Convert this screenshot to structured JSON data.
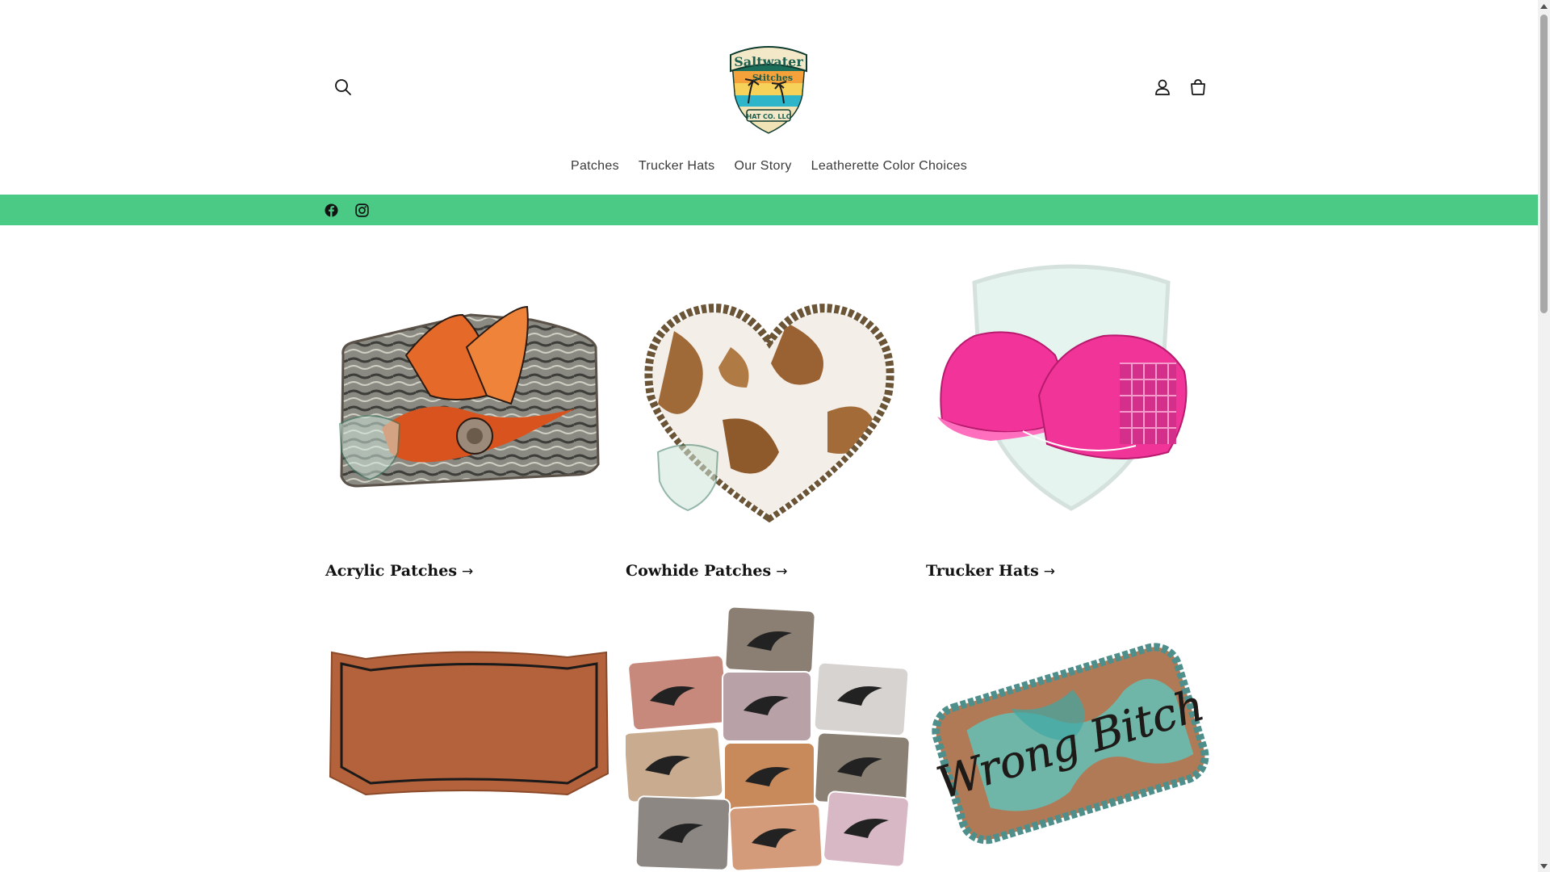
{
  "brand": {
    "logo_line1": "Saltwater",
    "logo_line2": "Stitches",
    "logo_line3": "HAT CO. LLC"
  },
  "header": {
    "icons": [
      "search-icon",
      "account-icon",
      "cart-icon"
    ]
  },
  "nav": {
    "items": [
      {
        "label": "Patches"
      },
      {
        "label": "Trucker Hats"
      },
      {
        "label": "Our Story"
      },
      {
        "label": "Leatherette Color Choices"
      }
    ]
  },
  "social": {
    "icons": [
      "facebook-icon",
      "instagram-icon"
    ],
    "bar_color": "#4bca86"
  },
  "collections": [
    {
      "title": "Acrylic Patches",
      "arrow": "→"
    },
    {
      "title": "Cowhide Patches",
      "arrow": "→"
    },
    {
      "title": "Trucker Hats",
      "arrow": "→"
    },
    {
      "title": "",
      "arrow": ""
    },
    {
      "title": "",
      "arrow": ""
    },
    {
      "title": "",
      "arrow": ""
    }
  ],
  "products": {
    "leather_patch_text": "Wrong Bitch"
  }
}
